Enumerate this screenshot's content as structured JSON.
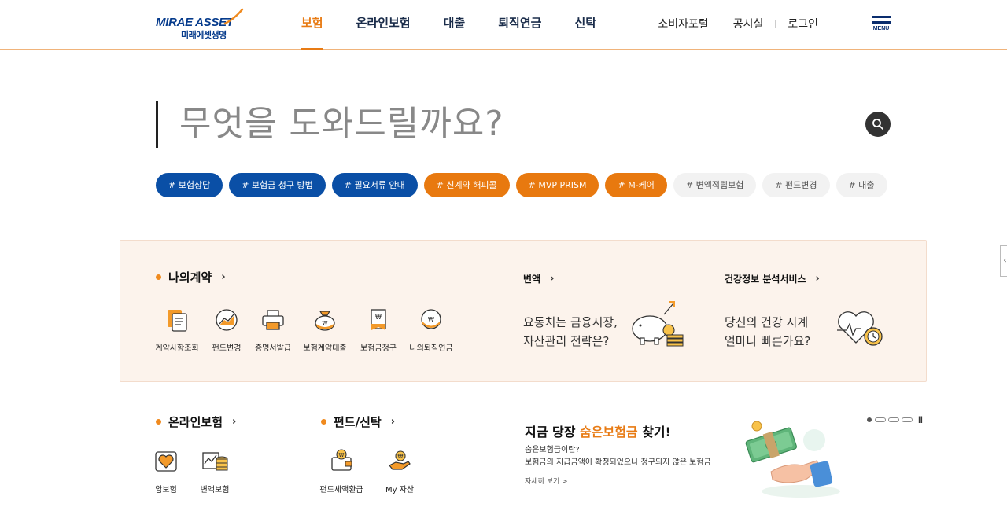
{
  "header": {
    "logo_en": "MIRAE ASSET",
    "logo_ko": "미래에셋생명",
    "nav": [
      {
        "label": "보험",
        "active": true
      },
      {
        "label": "온라인보험"
      },
      {
        "label": "대출"
      },
      {
        "label": "퇴직연금"
      },
      {
        "label": "신탁"
      }
    ],
    "util": [
      "소비자포털",
      "공시실",
      "로그인"
    ],
    "menu_label": "MENU"
  },
  "search": {
    "placeholder": "무엇을 도와드릴까요?"
  },
  "tags": [
    {
      "label": "# 보험상담",
      "style": "blue"
    },
    {
      "label": "# 보험금 청구 방법",
      "style": "blue"
    },
    {
      "label": "# 필요서류 안내",
      "style": "blue"
    },
    {
      "label": "# 신계약 해피콜",
      "style": "orange"
    },
    {
      "label": "# MVP PRISM",
      "style": "orange"
    },
    {
      "label": "# M-케어",
      "style": "orange"
    },
    {
      "label": "# 변액적립보험",
      "style": "gray"
    },
    {
      "label": "# 펀드변경",
      "style": "gray"
    },
    {
      "label": "# 대출",
      "style": "gray"
    }
  ],
  "my_contract": {
    "title": "나의계약",
    "items": [
      "계약사항조회",
      "펀드변경",
      "증명서발급",
      "보험계약대출",
      "보험금청구",
      "나의퇴직연금"
    ],
    "variable": {
      "title": "변액",
      "line1": "요동치는 금융시장,",
      "line2": "자산관리 전략은?"
    },
    "health": {
      "title": "건강정보 분석서비스",
      "line1": "당신의 건강 시계",
      "line2": "얼마나 빠른가요?"
    }
  },
  "online_insurance": {
    "title": "온라인보험",
    "items": [
      "암보험",
      "변액보험"
    ]
  },
  "fund_trust": {
    "title": "펀드/신탁",
    "items": [
      "펀드세액환급",
      "My 자산"
    ]
  },
  "promo": {
    "title_pre": "지금 당장 ",
    "title_hl": "숨은보험금",
    "title_post": " 찾기!",
    "desc1": "숨은보험금이란?",
    "desc2": "보험금의 지급금액이 확정되었으나 청구되지 않은 보험금",
    "more": "자세히 보기 >"
  },
  "colors": {
    "accent": "#e87b14",
    "brand": "#0a4fa6",
    "panel_bg": "#fcf3ec"
  }
}
